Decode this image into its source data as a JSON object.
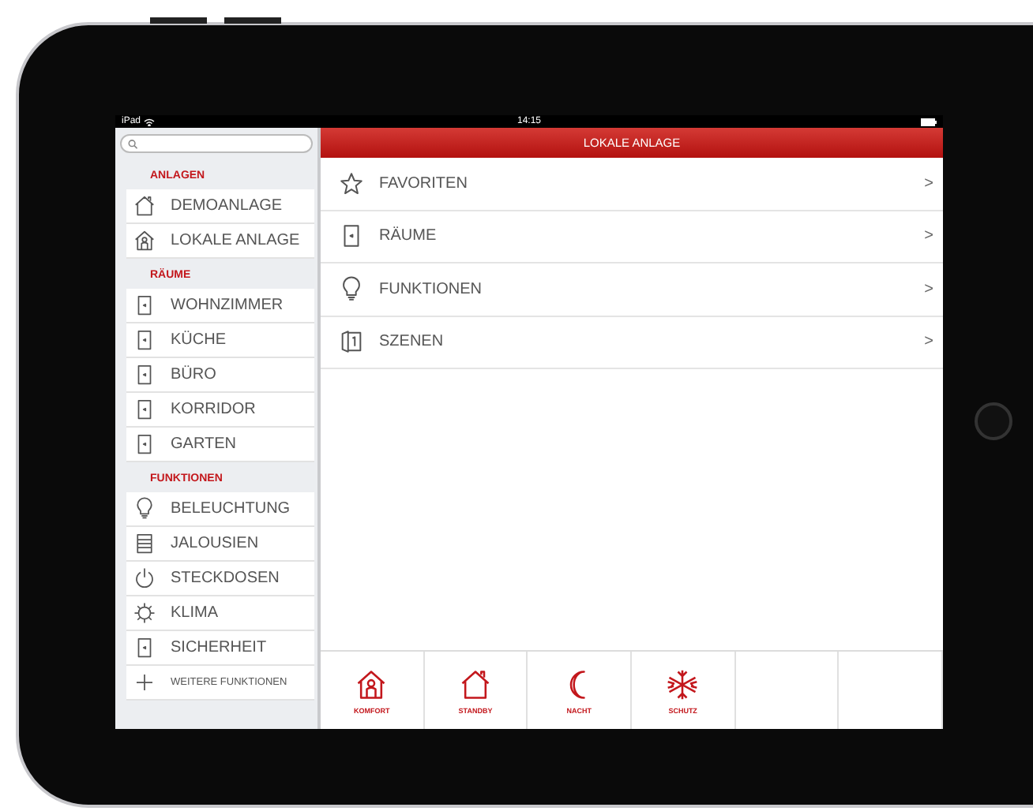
{
  "status_bar": {
    "device": "iPad",
    "time": "14:15"
  },
  "sidebar": {
    "sections": [
      {
        "title": "ANLAGEN",
        "items": [
          {
            "label": "DEMOANLAGE",
            "kind": "house"
          },
          {
            "label": "LOKALE ANLAGE",
            "kind": "house-person"
          }
        ]
      },
      {
        "title": "RÄUME",
        "items": [
          {
            "label": "WOHNZIMMER",
            "kind": "door"
          },
          {
            "label": "KÜCHE",
            "kind": "door"
          },
          {
            "label": "BÜRO",
            "kind": "door"
          },
          {
            "label": "KORRIDOR",
            "kind": "door"
          },
          {
            "label": "GARTEN",
            "kind": "door"
          }
        ]
      },
      {
        "title": "FUNKTIONEN",
        "items": [
          {
            "label": "BELEUCHTUNG",
            "kind": "bulb"
          },
          {
            "label": "JALOUSIEN",
            "kind": "blinds"
          },
          {
            "label": "STECKDOSEN",
            "kind": "power"
          },
          {
            "label": "KLIMA",
            "kind": "gear"
          },
          {
            "label": "SICHERHEIT",
            "kind": "door"
          },
          {
            "label": "WEITERE FUNKTIONEN",
            "kind": "plus"
          }
        ]
      }
    ]
  },
  "main": {
    "title": "LOKALE ANLAGE",
    "rows": [
      {
        "label": "FAVORITEN",
        "kind": "star",
        "chevron": ">"
      },
      {
        "label": "RÄUME",
        "kind": "door",
        "chevron": ">"
      },
      {
        "label": "FUNKTIONEN",
        "kind": "bulb",
        "chevron": ">"
      },
      {
        "label": "SZENEN",
        "kind": "scene",
        "chevron": ">"
      }
    ],
    "toolbar": [
      {
        "label": "KOMFORT",
        "kind": "house-person"
      },
      {
        "label": "STANDBY",
        "kind": "house"
      },
      {
        "label": "NACHT",
        "kind": "moon"
      },
      {
        "label": "SCHUTZ",
        "kind": "snowflake"
      }
    ]
  }
}
